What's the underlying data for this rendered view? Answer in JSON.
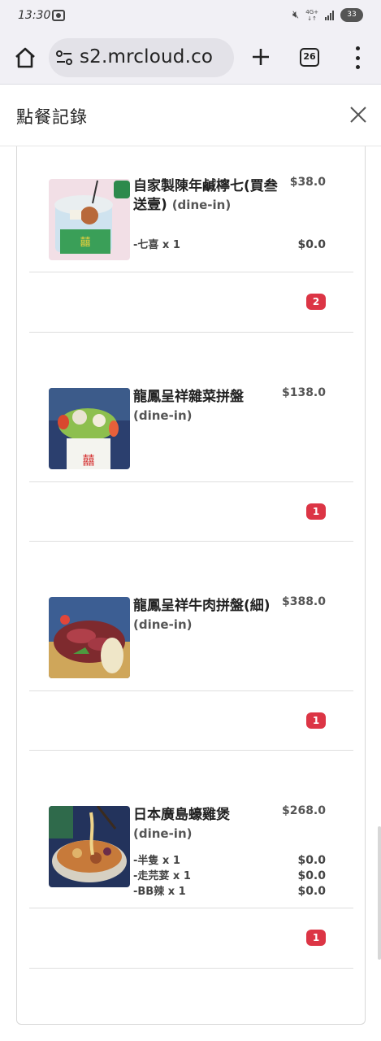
{
  "status_bar": {
    "time": "13:30",
    "network": "4G+",
    "battery": "33",
    "icons": [
      "camera-icon",
      "mute-icon",
      "signal-icon",
      "battery-icon"
    ]
  },
  "browser": {
    "url": "s2.mrcloud.co",
    "tab_count": "26",
    "icons": [
      "home-icon",
      "tune-icon",
      "plus-icon",
      "tab-switcher-icon",
      "more-vert-icon"
    ]
  },
  "modal": {
    "title": "點餐記錄",
    "close_icon": "close-icon"
  },
  "orders": [
    {
      "name": "自家製陳年鹹檸七(買叁送壹)",
      "dine": "(dine-in)",
      "price": "$38.0",
      "options": [
        {
          "label": "-七喜 x 1",
          "price": "$0.0"
        }
      ],
      "quantity": "2"
    },
    {
      "name": "龍鳳呈祥雜菜拼盤",
      "dine": "(dine-in)",
      "price": "$138.0",
      "options": [],
      "quantity": "1"
    },
    {
      "name": "龍鳳呈祥牛肉拼盤(細)",
      "dine": "(dine-in)",
      "price": "$388.0",
      "options": [],
      "quantity": "1"
    },
    {
      "name": "日本廣島蠔雞煲",
      "dine": "(dine-in)",
      "price": "$268.0",
      "options": [
        {
          "label": "-半隻 x 1",
          "price": "$0.0"
        },
        {
          "label": "-走芫荽 x 1",
          "price": "$0.0"
        },
        {
          "label": "-BB辣 x 1",
          "price": "$0.0"
        }
      ],
      "quantity": "1"
    }
  ],
  "colors": {
    "badge": "#dc3545",
    "toolbar_bg": "#f1f0f5",
    "url_bg": "#e3e2e8"
  }
}
